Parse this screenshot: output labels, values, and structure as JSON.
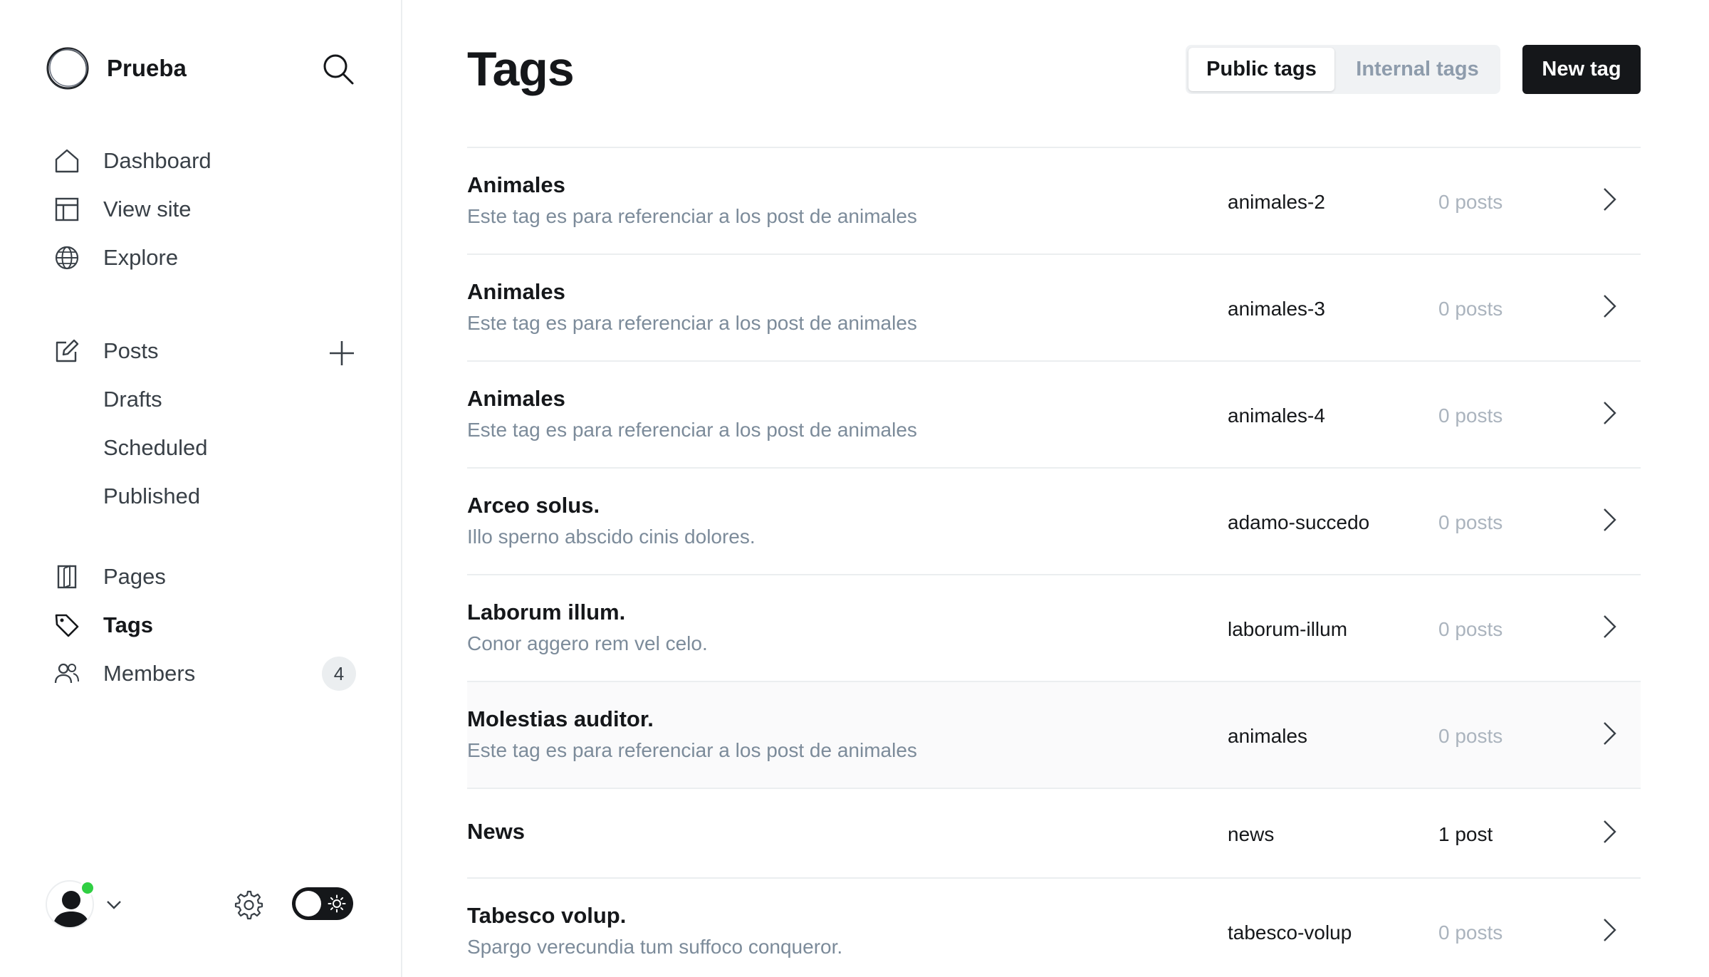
{
  "sidebar": {
    "site_name": "Prueba",
    "nav": {
      "dashboard": "Dashboard",
      "view_site": "View site",
      "explore": "Explore",
      "posts": "Posts",
      "drafts": "Drafts",
      "scheduled": "Scheduled",
      "published": "Published",
      "pages": "Pages",
      "tags": "Tags",
      "members": "Members",
      "members_count": "4"
    },
    "active_item": "Tags"
  },
  "header": {
    "title": "Tags",
    "segments": [
      "Public tags",
      "Internal tags"
    ],
    "selected_segment": "Public tags",
    "new_button": "New tag"
  },
  "tags": [
    {
      "name": "Animales",
      "description": "Este tag es para referenciar a los post de animales",
      "slug": "animales-2",
      "count": "0 posts"
    },
    {
      "name": "Animales",
      "description": "Este tag es para referenciar a los post de animales",
      "slug": "animales-3",
      "count": "0 posts"
    },
    {
      "name": "Animales",
      "description": "Este tag es para referenciar a los post de animales",
      "slug": "animales-4",
      "count": "0 posts"
    },
    {
      "name": "Arceo solus.",
      "description": "Illo sperno abscido cinis dolores.",
      "slug": "adamo-succedo",
      "count": "0 posts"
    },
    {
      "name": "Laborum illum.",
      "description": "Conor aggero rem vel celo.",
      "slug": "laborum-illum",
      "count": "0 posts"
    },
    {
      "name": "Molestias auditor.",
      "description": "Este tag es para referenciar a los post de animales",
      "slug": "animales",
      "count": "0 posts"
    },
    {
      "name": "News",
      "description": "",
      "slug": "news",
      "count": "1 post"
    },
    {
      "name": "Tabesco volup.",
      "description": "Spargo verecundia tum suffoco conqueror.",
      "slug": "tabesco-volup",
      "count": "0 posts"
    }
  ],
  "colors": {
    "accent": "#15171a",
    "online_status": "#30cf43",
    "muted_text": "#7c8b9a"
  }
}
